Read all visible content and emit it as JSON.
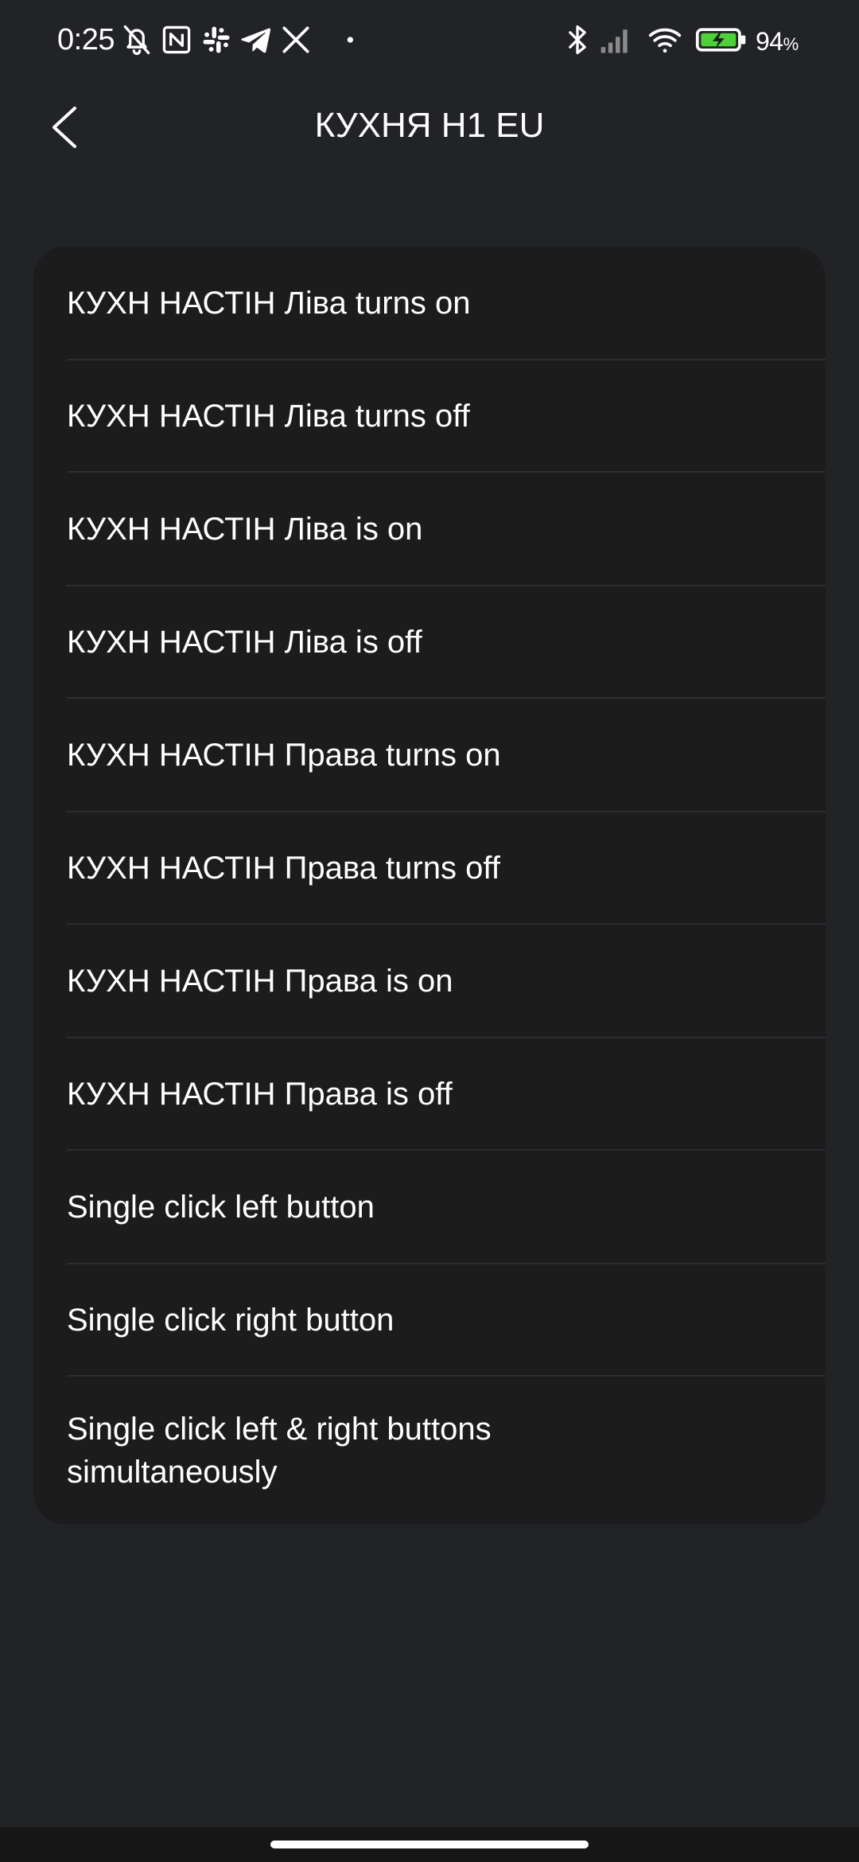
{
  "status_bar": {
    "time": "0:25",
    "battery_percent": "94",
    "battery_percent_sign": "%",
    "icons": [
      "bell-off-icon",
      "nfc-icon",
      "slack-icon",
      "telegram-icon",
      "x-icon",
      "dot-icon",
      "bluetooth-icon",
      "signal-icon",
      "wifi-icon",
      "battery-charging-icon"
    ]
  },
  "header": {
    "title": "КУХНЯ H1 EU",
    "back_icon": "chevron-left-icon"
  },
  "list": {
    "items": [
      {
        "label": "КУХН НАСТІН Ліва turns on"
      },
      {
        "label": "КУХН НАСТІН Ліва turns off"
      },
      {
        "label": "КУХН НАСТІН Ліва is on"
      },
      {
        "label": "КУХН НАСТІН Ліва is off"
      },
      {
        "label": "КУХН НАСТІН Права turns on"
      },
      {
        "label": "КУХН НАСТІН Права turns off"
      },
      {
        "label": "КУХН НАСТІН Права is on"
      },
      {
        "label": "КУХН НАСТІН Права is off"
      },
      {
        "label": "Single click left button"
      },
      {
        "label": "Single click right button"
      },
      {
        "label": "Single click left & right buttons simultaneously"
      }
    ]
  },
  "colors": {
    "background": "#222326",
    "card": "#1c1c1d",
    "divider": "#2d2d2f",
    "text": "#ffffff",
    "battery_fill": "#4cd137"
  }
}
